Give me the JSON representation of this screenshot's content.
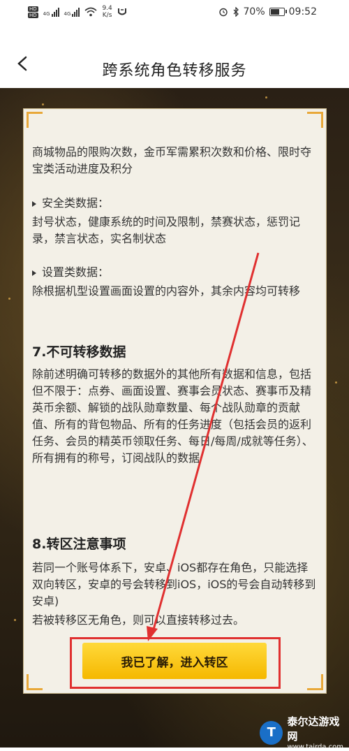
{
  "status_bar": {
    "hd1": "HD",
    "hd2": "HD",
    "net1": "4G",
    "net2": "4G",
    "speed_value": "9.4",
    "speed_unit": "K/s",
    "battery": "70%",
    "battery_level": 0.7,
    "time": "09:52"
  },
  "header": {
    "title": "跨系统角色转移服务"
  },
  "content": {
    "para1": "商城物品的限购次数，金币军需累积次数和价格、限时夺宝类活动进度及积分",
    "safety_title": "安全类数据：",
    "safety_text": "封号状态，健康系统的时间及限制，禁赛状态，惩罚记录，禁言状态，实名制状态",
    "settings_title": "设置类数据：",
    "settings_text": "除根据机型设置画面设置的内容外，其余内容均可转移",
    "section7_title": "7.不可转移数据",
    "section7_text": "除前述明确可转移的数据外的其他所有数据和信息，包括但不限于：点券、画面设置、赛事会员状态、赛事币及精英币余额、解锁的战队勋章数量、每个战队勋章的贡献值、所有的背包物品、所有的任务进度（包括会员的返利任务、会员的精英币领取任务、每日/每周/成就等任务）、所有拥有的称号，订阅战队的数据",
    "section8_title": "8.转区注意事项",
    "section8_text1": "若同一个账号体系下，安卓、iOS都存在角色，只能选择双向转区，安卓的号会转移到iOS，iOS的号会自动转移到安卓)",
    "section8_text2": "若被转移区无角色，则可以直接转移过去。"
  },
  "button": {
    "label": "我已了解，进入转区"
  },
  "watermark": {
    "name": "泰尔达游戏网",
    "url": "www.tairda.com"
  },
  "colors": {
    "accent": "#f5b800",
    "annotation_red": "#e03030",
    "corner": "#e8a83a"
  }
}
